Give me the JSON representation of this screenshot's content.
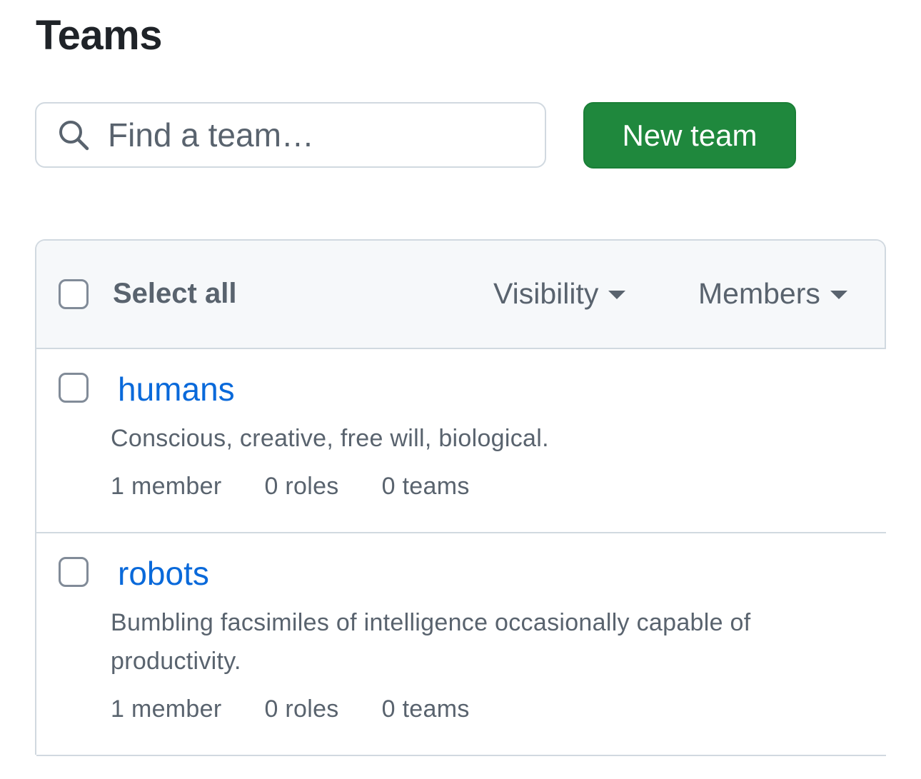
{
  "page": {
    "title": "Teams"
  },
  "search": {
    "placeholder": "Find a team…"
  },
  "toolbar": {
    "new_team_label": "New team",
    "accent_color": "#1f883d"
  },
  "table_header": {
    "select_all_label": "Select all",
    "visibility_label": "Visibility",
    "members_label": "Members"
  },
  "teams": [
    {
      "name": "humans",
      "description": "Conscious, creative, free will, biological.",
      "members": "1 member",
      "roles": "0 roles",
      "teams": "0 teams"
    },
    {
      "name": "robots",
      "description": "Bumbling facsimiles of intelligence occasionally capable of productivity.",
      "members": "1 member",
      "roles": "0 roles",
      "teams": "0 teams"
    }
  ],
  "colors": {
    "link": "#0969da",
    "muted_text": "#59636e",
    "border": "#d1d9e0",
    "header_bg": "#f6f8fa"
  }
}
